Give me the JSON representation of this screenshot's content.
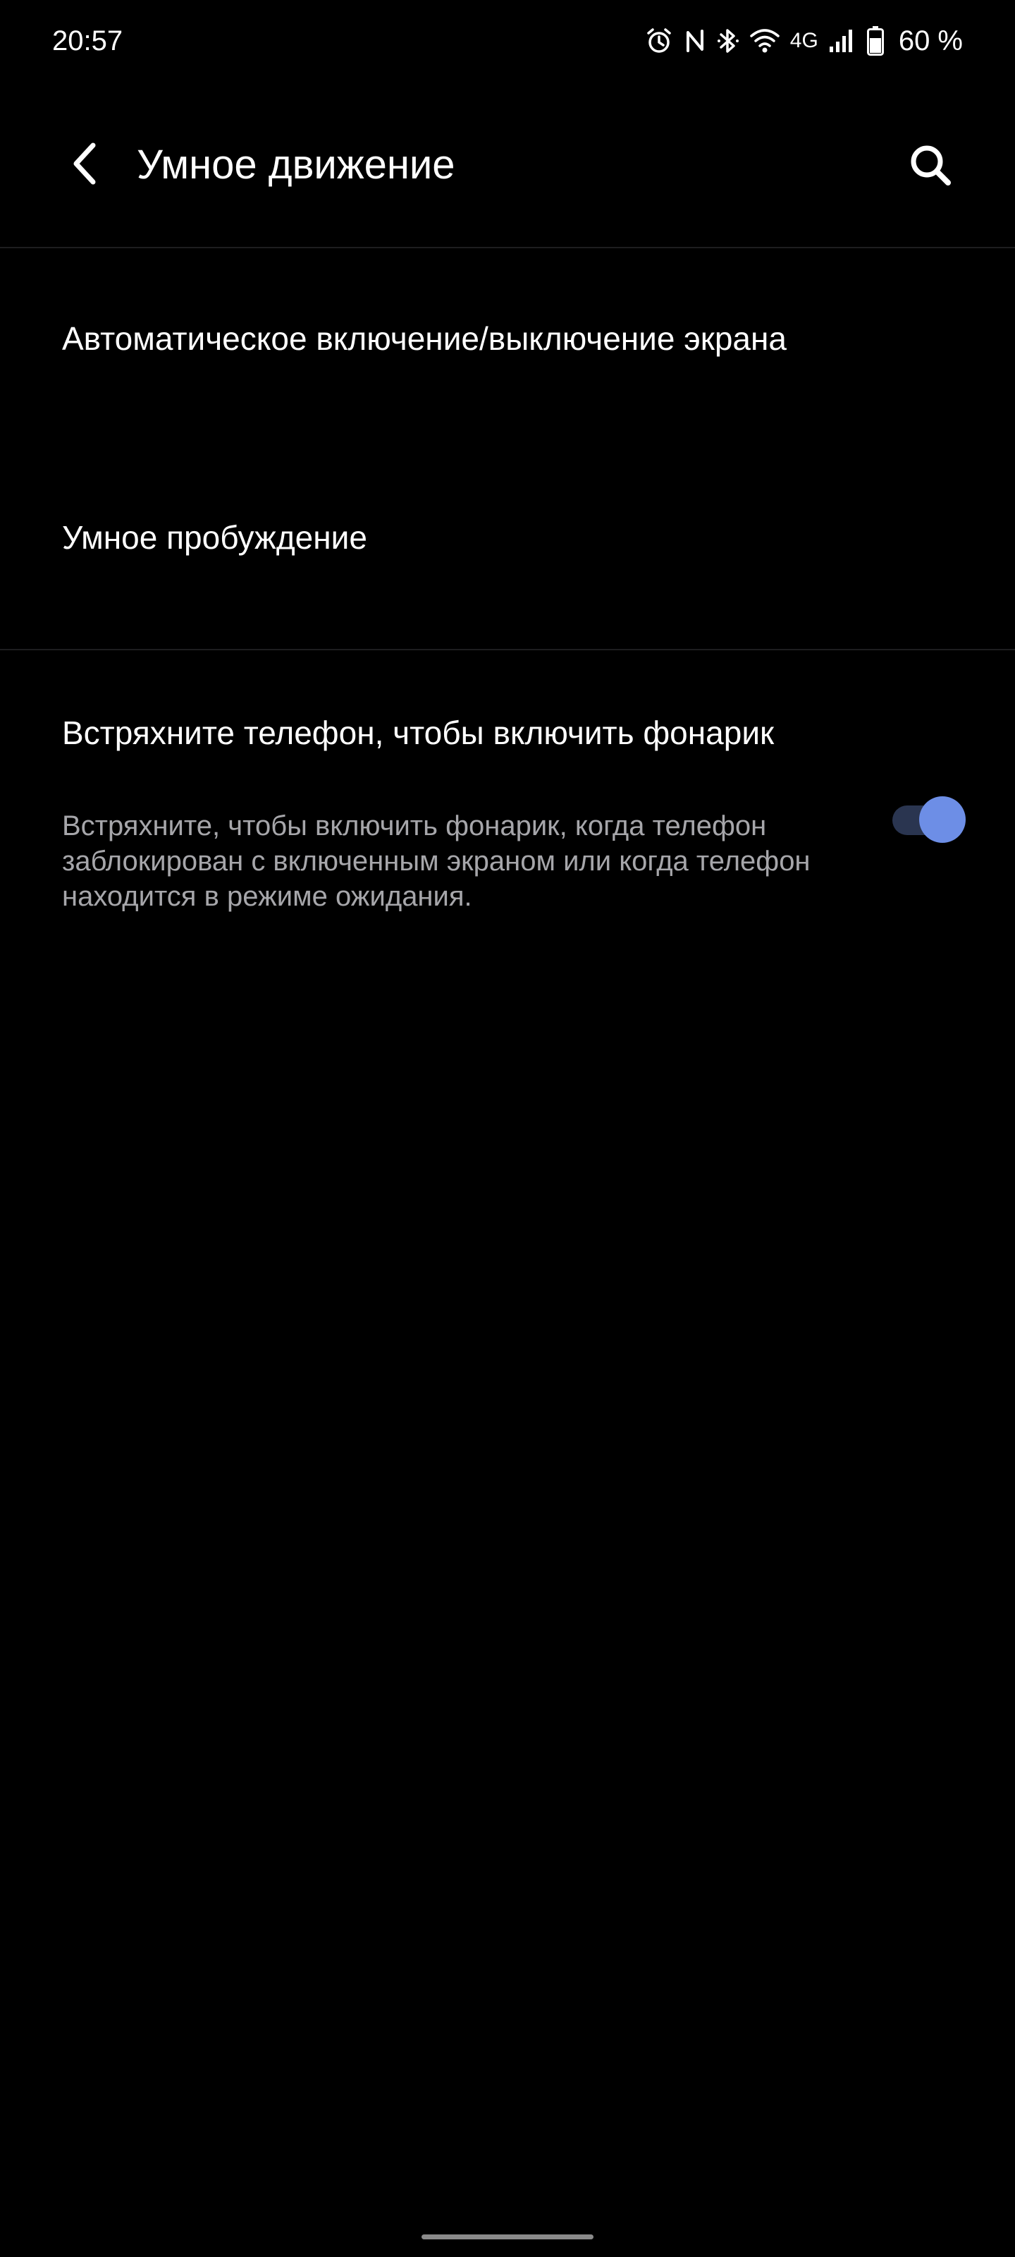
{
  "status_bar": {
    "time": "20:57",
    "network_type": "4G",
    "battery_percent": "60 %",
    "icons": [
      "alarm-icon",
      "nfc-icon",
      "bluetooth-icon",
      "wifi-icon",
      "signal-icon",
      "battery-icon"
    ]
  },
  "app_bar": {
    "title": "Умное движение",
    "back_icon": "chevron-left-icon",
    "search_icon": "search-icon"
  },
  "settings": {
    "items": [
      {
        "title": "Автоматическое включение/выключение экрана"
      },
      {
        "title": "Умное пробуждение"
      }
    ],
    "toggle_item": {
      "title": "Встряхните телефон, чтобы включить фонарик",
      "summary": "Встряхните, чтобы включить фонарик, когда телефон заблокирован с включенным экраном или когда телефон находится в режиме ожидания.",
      "enabled": true
    }
  },
  "colors": {
    "background": "#000000",
    "text_primary": "#ffffff",
    "text_secondary": "#a6a6aa",
    "accent": "#6d8ee6",
    "switch_track_on": "#2a3550",
    "divider": "#1d1d1f"
  }
}
